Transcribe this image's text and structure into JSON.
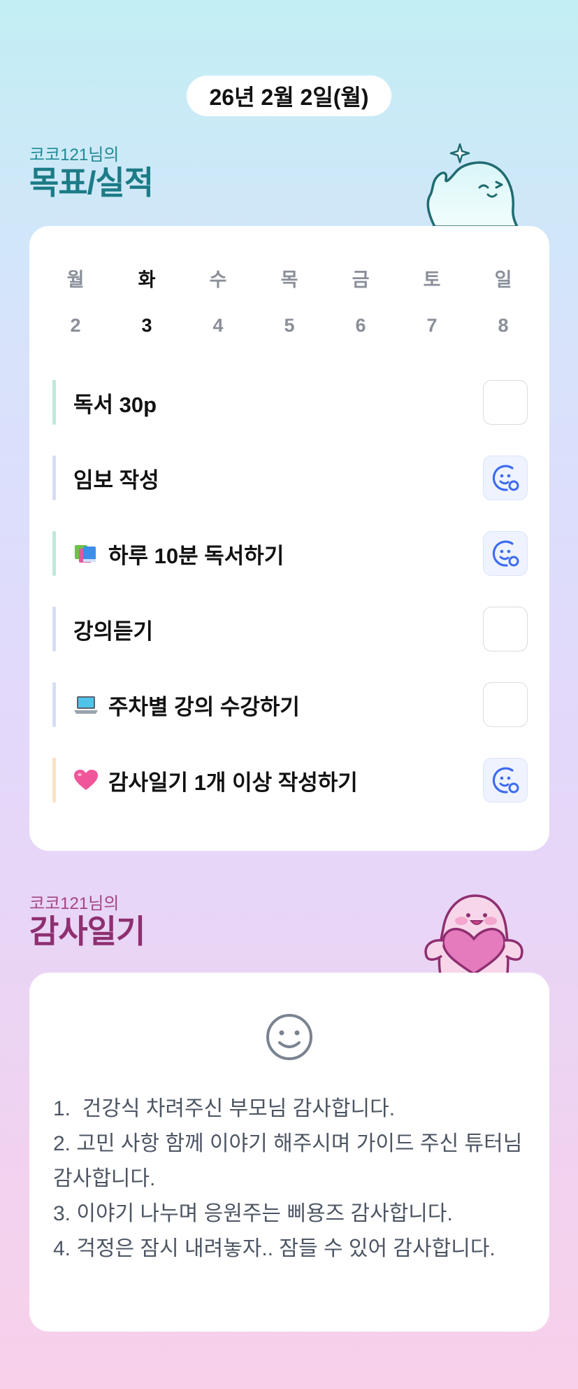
{
  "date_label": "26년 2월 2일(월)",
  "goals_section": {
    "subtitle": "코코121님의",
    "title": "목표/실적"
  },
  "week": {
    "days": [
      {
        "name": "월",
        "date": "2",
        "active": false
      },
      {
        "name": "화",
        "date": "3",
        "active": true
      },
      {
        "name": "수",
        "date": "4",
        "active": false
      },
      {
        "name": "목",
        "date": "5",
        "active": false
      },
      {
        "name": "금",
        "date": "6",
        "active": false
      },
      {
        "name": "토",
        "date": "7",
        "active": false
      },
      {
        "name": "일",
        "date": "8",
        "active": false
      }
    ]
  },
  "goals": [
    {
      "icon": "",
      "label": "독서 30p",
      "bar_color": "#bfe8da",
      "completed": false
    },
    {
      "icon": "",
      "label": "임보 작성",
      "bar_color": "#d5def3",
      "completed": true
    },
    {
      "icon": "books-icon",
      "label": "하루 10분 독서하기",
      "bar_color": "#bfe8da",
      "completed": true
    },
    {
      "icon": "",
      "label": "강의듣기",
      "bar_color": "#d5def3",
      "completed": false
    },
    {
      "icon": "laptop-icon",
      "label": "주차별 강의 수강하기",
      "bar_color": "#d5def3",
      "completed": false
    },
    {
      "icon": "pink-heart-icon",
      "label": "감사일기 1개 이상 작성하기",
      "bar_color": "#fde1c4",
      "completed": true
    }
  ],
  "thanks_section": {
    "subtitle": "코코121님의",
    "title": "감사일기",
    "mood_icon": "neutral-smile-icon",
    "entries": [
      "1.  건강식 차려주신 부모님 감사합니다.",
      "2. 고민 사항 함께 이야기 해주시며 가이드 주신 튜터님 감사합니다.",
      "3. 이야기 나누며 응원주는 삐용즈 감사합니다.",
      "4. 걱정은 잠시 내려놓자.. 잠들 수 있어 감사합니다."
    ]
  },
  "colors": {
    "goal_title": "#1c7b86",
    "thanks_title": "#8e2f70",
    "check_done_bg": "#eef3ff",
    "check_done_icon": "#3d6bf0"
  }
}
